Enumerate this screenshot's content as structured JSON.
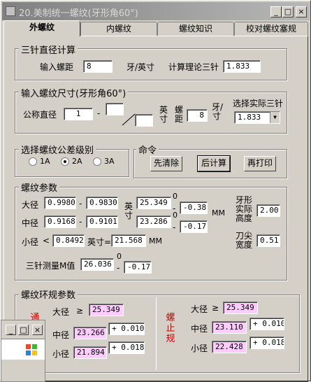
{
  "window": {
    "title": "20.美制统一螺纹(牙形角60°)",
    "min": "_",
    "max": "□",
    "close": "×"
  },
  "tabs": [
    {
      "label": "外螺纹"
    },
    {
      "label": "内螺纹"
    },
    {
      "label": "螺纹知识"
    },
    {
      "label": "校对螺纹塞规"
    }
  ],
  "sanzhen": {
    "title": "三针直径计算",
    "pitch_label": "输入螺距",
    "pitch_value": "8",
    "unit": "牙/英寸",
    "theory_label": "计算理论三针",
    "theory_value": "1.833"
  },
  "size": {
    "title": "输入螺纹尺寸(牙形角60°)",
    "nominal_label": "公称直径",
    "nominal_value": "1",
    "dash": "-",
    "frac_num": "",
    "frac_den": "",
    "inch_label": "英寸",
    "pitch_label": "螺距",
    "pitch_value": "8",
    "tpi_label": "牙/寸",
    "select_label": "选择实际三针",
    "select_value": "1.833",
    "select_arrow": "▼"
  },
  "tolerance": {
    "title": "选择螺纹公差级别",
    "options": [
      "1A",
      "2A",
      "3A"
    ],
    "selected": "2A"
  },
  "command": {
    "title": "命令",
    "clear": "先清除",
    "calc": "后计算",
    "print": "再打印"
  },
  "params": {
    "title": "螺纹参数",
    "major_label": "大径",
    "major_min": "0.9980",
    "dash1": "-",
    "major_max": "0.9830",
    "inch_mm": "英寸",
    "mm_major": "25.349",
    "tol_top_major": "0",
    "tol_bot_major": "-0.381",
    "mm_unit": "MM",
    "pitch_label": "中径",
    "pitch_min": "0.9168",
    "dash2": "-",
    "pitch_max": "0.9101",
    "mm_pitch": "23.286",
    "tol_top_pitch": "0",
    "tol_bot_pitch": "-0.171",
    "minor_label": "小径",
    "lt": "<",
    "minor_inch": "0.8492",
    "minor_inch_label": "英寸=",
    "minor_mm": "21.568",
    "minor_unit": "MM",
    "m_label": "三针测量M值",
    "m_value": "26.036",
    "m_top": "0",
    "m_bot": "-0.171",
    "flank_label": "牙形实际高度",
    "flank_value": "2.00",
    "crest_label": "刀尖宽度",
    "crest_value": "0.51"
  },
  "ring": {
    "title": "螺纹环规参数",
    "go_label": "通规",
    "nogo_label": "螺止规",
    "go": {
      "major_label": "大径",
      "ge": "≥",
      "major": "25.349",
      "pitch_label": "中径",
      "pitch": "23.266",
      "pitch_tol": "+ 0.010",
      "minor_label": "小径",
      "minor": "21.894",
      "minor_tol": "+ 0.018"
    },
    "nogo": {
      "major_label": "大径",
      "ge": "≥",
      "major": "25.349",
      "pitch_label": "中径",
      "pitch": "23.110",
      "pitch_tol": "+ 0.010",
      "minor_label": "小径",
      "minor": "22.428",
      "minor_tol": "+ 0.018"
    }
  },
  "subwindow": {
    "min": "_",
    "max": "□",
    "close": "×"
  },
  "colors": {
    "ring_red": "#cc0000",
    "pink": "#ffccff"
  }
}
